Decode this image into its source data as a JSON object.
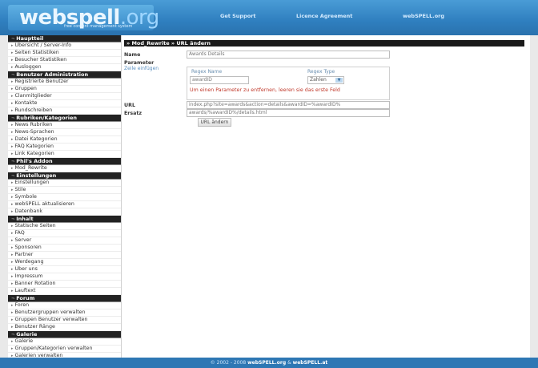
{
  "header": {
    "logo_main": "webspell",
    "logo_suffix": ".org",
    "logo_tagline": "free content management system",
    "nav": [
      "Get Support",
      "Licence Agreement",
      "webSPELL.org"
    ]
  },
  "sidebar": [
    {
      "title": "Hauptteil",
      "items": [
        "Übersicht / Server-Info",
        "Seiten Statistiken",
        "Besucher Statistiken",
        "Ausloggen"
      ]
    },
    {
      "title": "Benutzer Administration",
      "items": [
        "Registrierte Benutzer",
        "Gruppen",
        "Clanmitglieder",
        "Kontakte",
        "Rundschreiben"
      ]
    },
    {
      "title": "Rubriken/Kategorien",
      "items": [
        "News Rubriken",
        "News-Sprachen",
        "Datei Kategorien",
        "FAQ Kategorien",
        "Link Kategorien"
      ]
    },
    {
      "title": "Phil's Addon",
      "items": [
        "Mod_Rewrite"
      ]
    },
    {
      "title": "Einstellungen",
      "items": [
        "Einstellungen",
        "Stile",
        "Symbole",
        "webSPELL aktualisieren",
        "Datenbank"
      ]
    },
    {
      "title": "Inhalt",
      "items": [
        "Statische Seiten",
        "FAQ",
        "Server",
        "Sponsoren",
        "Partner",
        "Werdegang",
        "Über uns",
        "Impressum",
        "Banner Rotation",
        "Lauftext"
      ]
    },
    {
      "title": "Forum",
      "items": [
        "Foren",
        "Benutzergruppen verwalten",
        "Gruppen Benutzer verwalten",
        "Benutzer Ränge"
      ]
    },
    {
      "title": "Galerie",
      "items": [
        "Galerie",
        "Gruppen/Kategorien verwalten",
        "Galerien verwalten"
      ]
    }
  ],
  "content": {
    "title": "» Mod_Rewrite » URL ändern",
    "name_label": "Name",
    "name_value": "Awards Details",
    "param_label": "Parameter",
    "param_sublabel": "Zeile einfügen",
    "col_regex_name": "Regex Name",
    "col_regex_type": "Regex Type",
    "regex_name_value": "awardID",
    "regex_type_value": "Zahlen",
    "hint": "Um einen Parameter zu entfernen, leeren sie das erste Feld",
    "url_label": "URL",
    "url_value": "index.php?site=awards&action=details&awardID=%awardID%",
    "ersatz_label": "Ersatz",
    "ersatz_value": "awards/%awardID%/details.html",
    "button_label": "URL ändern"
  },
  "footer": {
    "copyright": "© 2002 - 2008",
    "link1": "webSPELL.org",
    "sep": "&",
    "link2": "webSPELL.at"
  }
}
